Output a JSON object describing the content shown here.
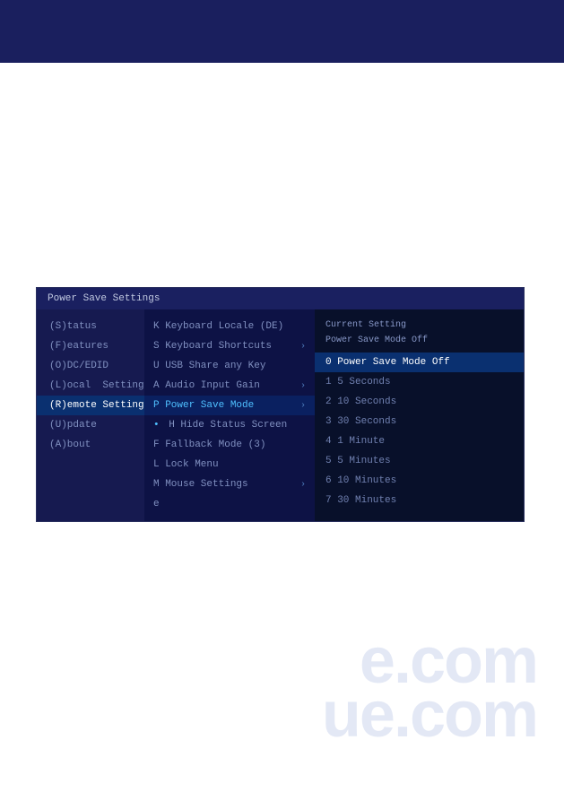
{
  "topbar": {
    "color": "#1a1f5e"
  },
  "watermark": {
    "line1": "e.com",
    "line2": "ue.com"
  },
  "menu": {
    "title": "Power Save Settings",
    "left_items": [
      {
        "label": "(S)tatus",
        "active": false
      },
      {
        "label": "(F)eatures",
        "active": false
      },
      {
        "label": "(O)DC/EDID",
        "active": false
      },
      {
        "label": "(L)ocal  Settings",
        "active": false
      },
      {
        "label": "(R)emote Settings",
        "active": true
      },
      {
        "label": "(U)pdate",
        "active": false
      },
      {
        "label": "(A)bout",
        "active": false
      }
    ],
    "mid_items": [
      {
        "label": "K Keyboard Locale (DE)",
        "has_arrow": false,
        "has_bullet": false,
        "active": false
      },
      {
        "label": "S Keyboard Shortcuts",
        "has_arrow": true,
        "has_bullet": false,
        "active": false
      },
      {
        "label": "U USB Share any Key",
        "has_arrow": false,
        "has_bullet": false,
        "active": false
      },
      {
        "label": "A Audio Input Gain",
        "has_arrow": true,
        "has_bullet": false,
        "active": false
      },
      {
        "label": "P Power Save Mode",
        "has_arrow": true,
        "has_bullet": false,
        "active": true
      },
      {
        "label": "H Hide Status Screen",
        "has_arrow": false,
        "has_bullet": true,
        "active": false
      },
      {
        "label": "F Fallback Mode (3)",
        "has_arrow": false,
        "has_bullet": false,
        "active": false
      },
      {
        "label": "L Lock Menu",
        "has_arrow": false,
        "has_bullet": false,
        "active": false
      },
      {
        "label": "M Mouse Settings",
        "has_arrow": true,
        "has_bullet": false,
        "active": false
      },
      {
        "label": "e",
        "has_arrow": false,
        "has_bullet": false,
        "active": false
      }
    ],
    "current_setting": {
      "label": "Current Setting",
      "value": "Power Save Mode Off"
    },
    "right_items": [
      {
        "label": "0 Power Save Mode Off",
        "selected": true
      },
      {
        "label": "1 5 Seconds",
        "selected": false
      },
      {
        "label": "2 10 Seconds",
        "selected": false
      },
      {
        "label": "3 30 Seconds",
        "selected": false
      },
      {
        "label": "4 1 Minute",
        "selected": false
      },
      {
        "label": "5 5 Minutes",
        "selected": false
      },
      {
        "label": "6 10 Minutes",
        "selected": false
      },
      {
        "label": "7 30 Minutes",
        "selected": false
      }
    ]
  }
}
